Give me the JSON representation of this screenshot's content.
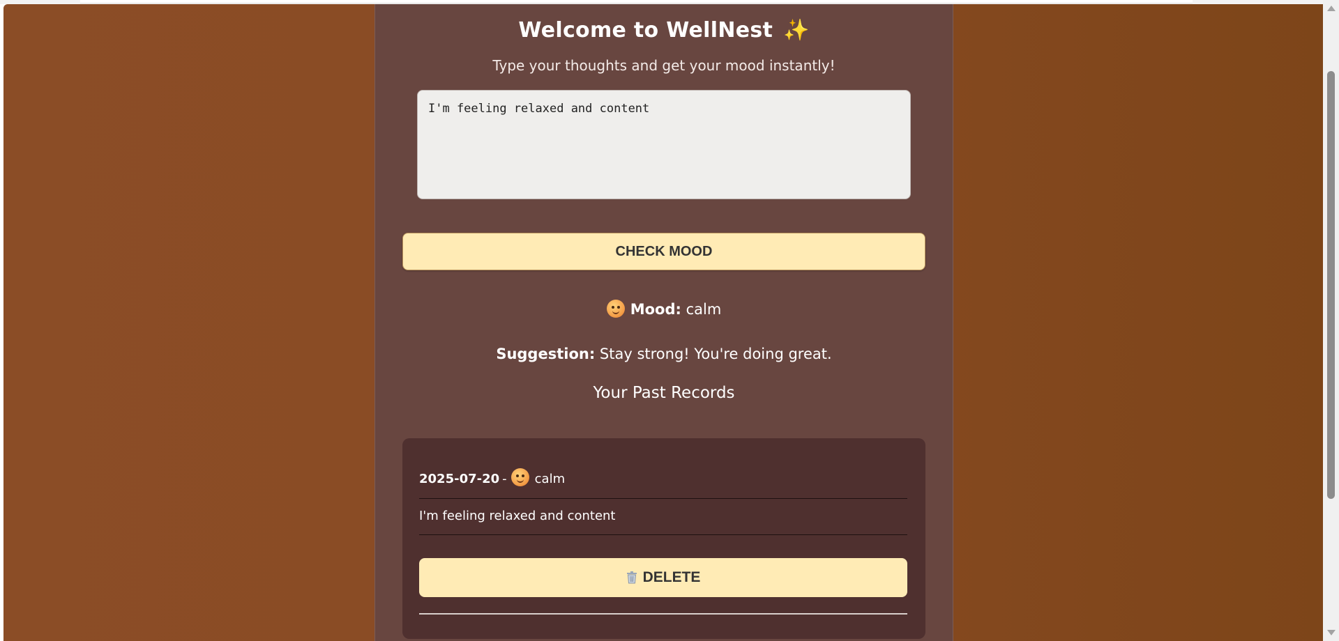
{
  "header": {
    "title": "Welcome to WellNest",
    "title_icon": "✨",
    "subtitle": "Type your thoughts and get your mood instantly!"
  },
  "input": {
    "value": "I'm feeling relaxed and content"
  },
  "buttons": {
    "check_mood": "CHECK MOOD",
    "delete": "DELETE"
  },
  "result": {
    "mood_label": "Mood:",
    "mood_value": "calm",
    "suggestion_label": "Suggestion:",
    "suggestion_value": "Stay strong! You're doing great."
  },
  "past": {
    "title": "Your Past Records",
    "records": [
      {
        "date": "2025-07-20",
        "separator": "-",
        "mood": "calm",
        "text": "I'm feeling relaxed and content"
      }
    ]
  },
  "colors": {
    "background_brown": "#8b4d26",
    "card_bg": "#684640",
    "record_bg": "#4f302f",
    "button_bg": "#ffebb5"
  }
}
